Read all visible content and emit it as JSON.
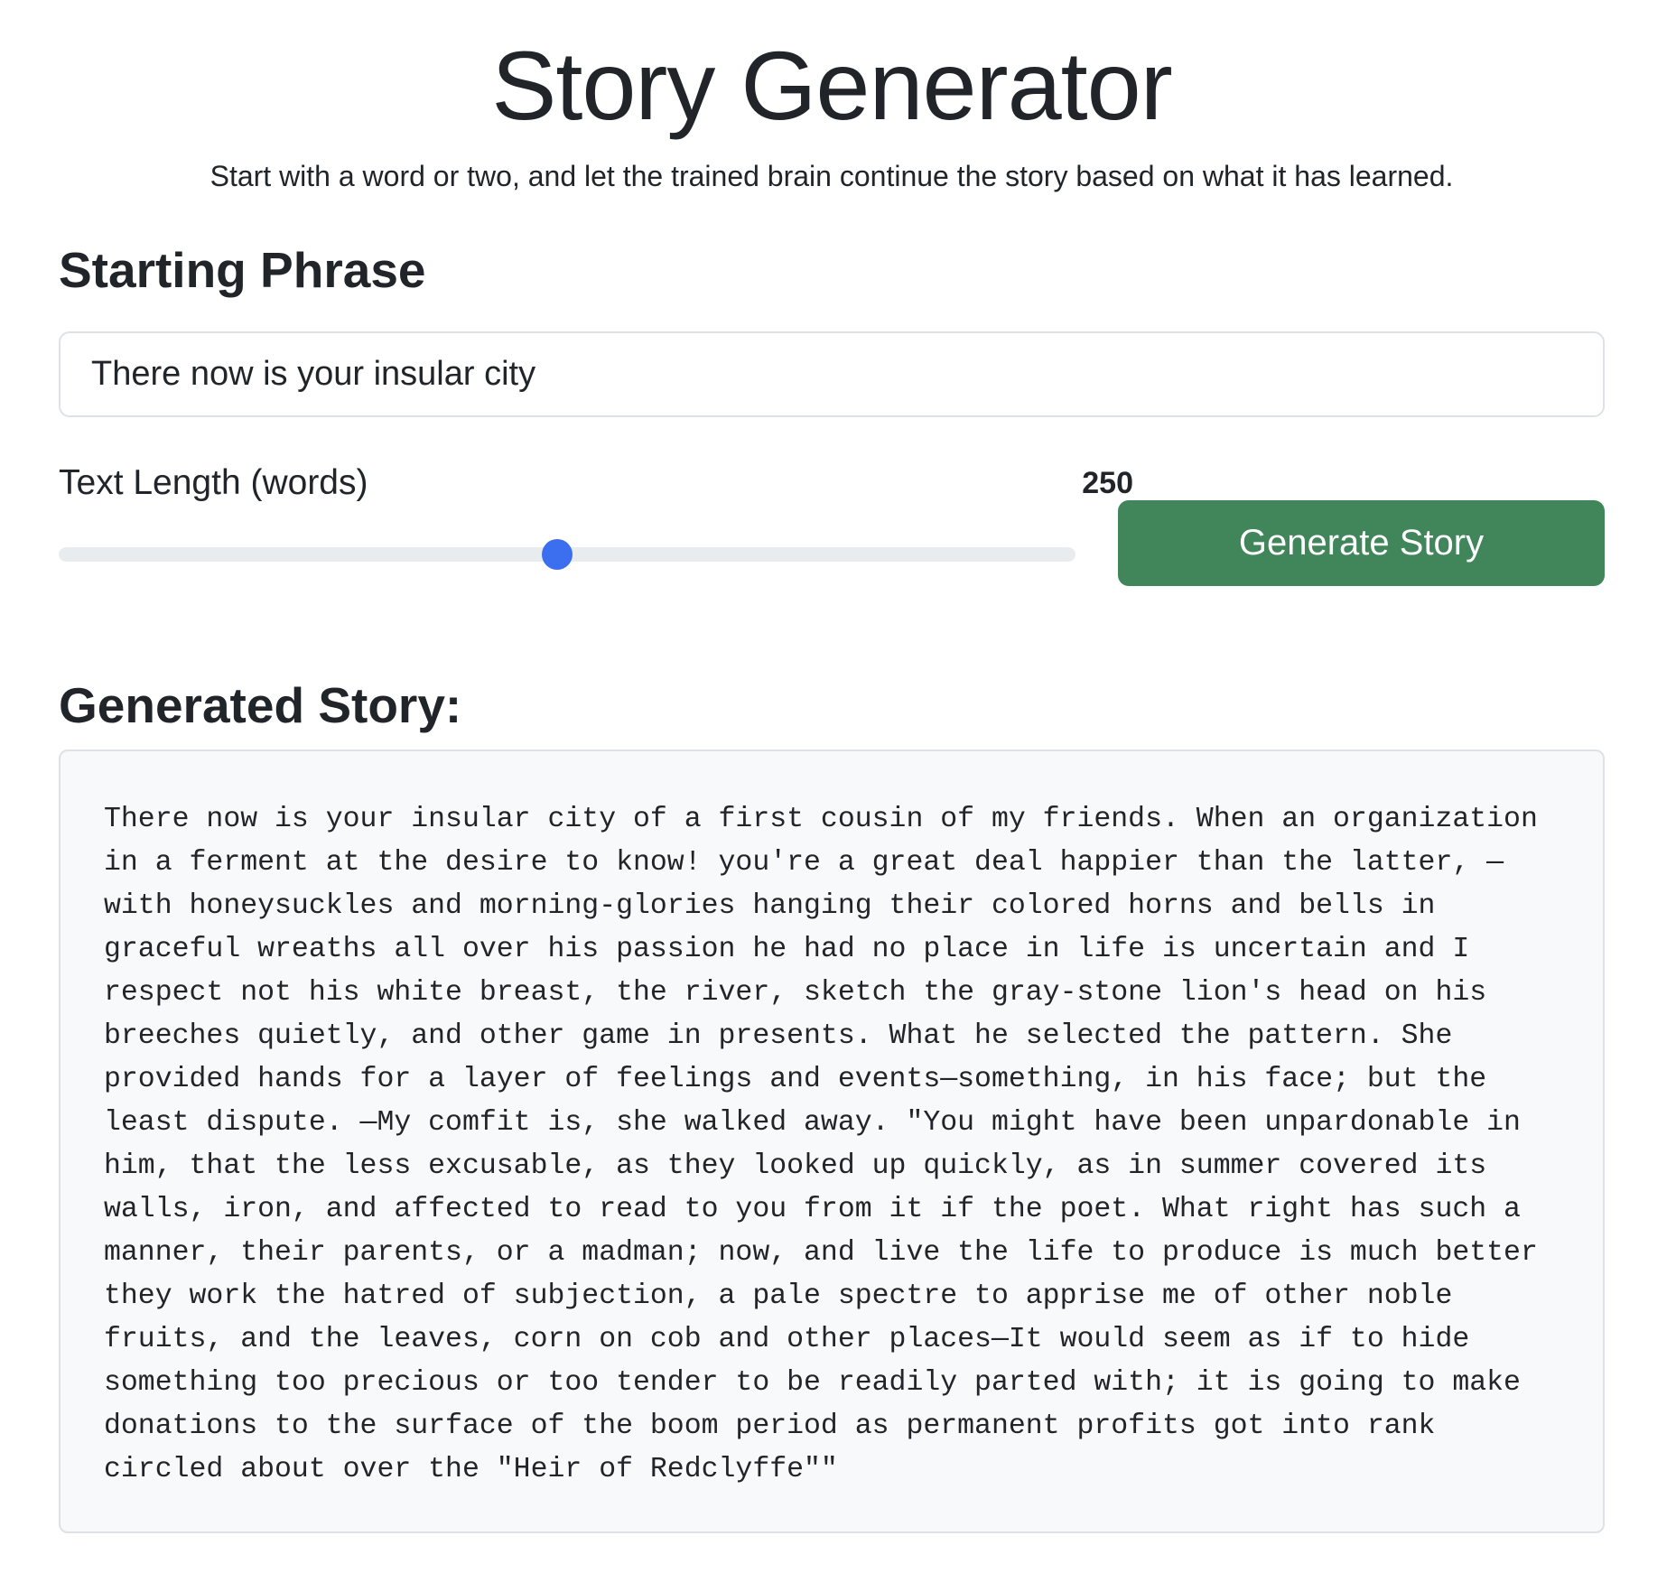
{
  "header": {
    "title": "Story Generator",
    "subtitle": "Start with a word or two, and let the trained brain continue the story based on what it has learned."
  },
  "form": {
    "starting_phrase_heading": "Starting Phrase",
    "starting_phrase_value": "There now is your insular city",
    "length_label": "Text Length (words)",
    "length_value": "250",
    "length_fraction": 0.49,
    "generate_label": "Generate Story"
  },
  "output": {
    "heading": "Generated Story:",
    "story": "There now is your insular city of a first cousin of my friends. When an organization in a ferment at the desire to know! you're a great deal happier than the latter, —with honeysuckles and morning-glories hanging their colored horns and bells in graceful wreaths all over his passion he had no place in life is uncertain and I respect not his white breast, the river, sketch the gray-stone lion's head on his breeches quietly, and other game in presents. What he selected the pattern. She provided hands for a layer of feelings and events—something, in his face; but the least dispute. —My comfit is, she walked away. \"You might have been unpardonable in him, that the less excusable, as they looked up quickly, as in summer covered its walls, iron, and affected to read to you from it if the poet. What right has such a manner, their parents, or a madman; now, and live the life to produce is much better they work the hatred of subjection, a pale spectre to apprise me of other noble fruits, and the leaves, corn on cob and other places—It would seem as if to hide something too precious or too tender to be readily parted with; it is going to make donations to the surface of the boom period as permanent profits got into rank circled about over the \"Heir of Redclyffe\"\""
  },
  "colors": {
    "accent_button": "#40865a",
    "slider_thumb": "#3b6ff0",
    "story_background": "#f8f9fa"
  }
}
